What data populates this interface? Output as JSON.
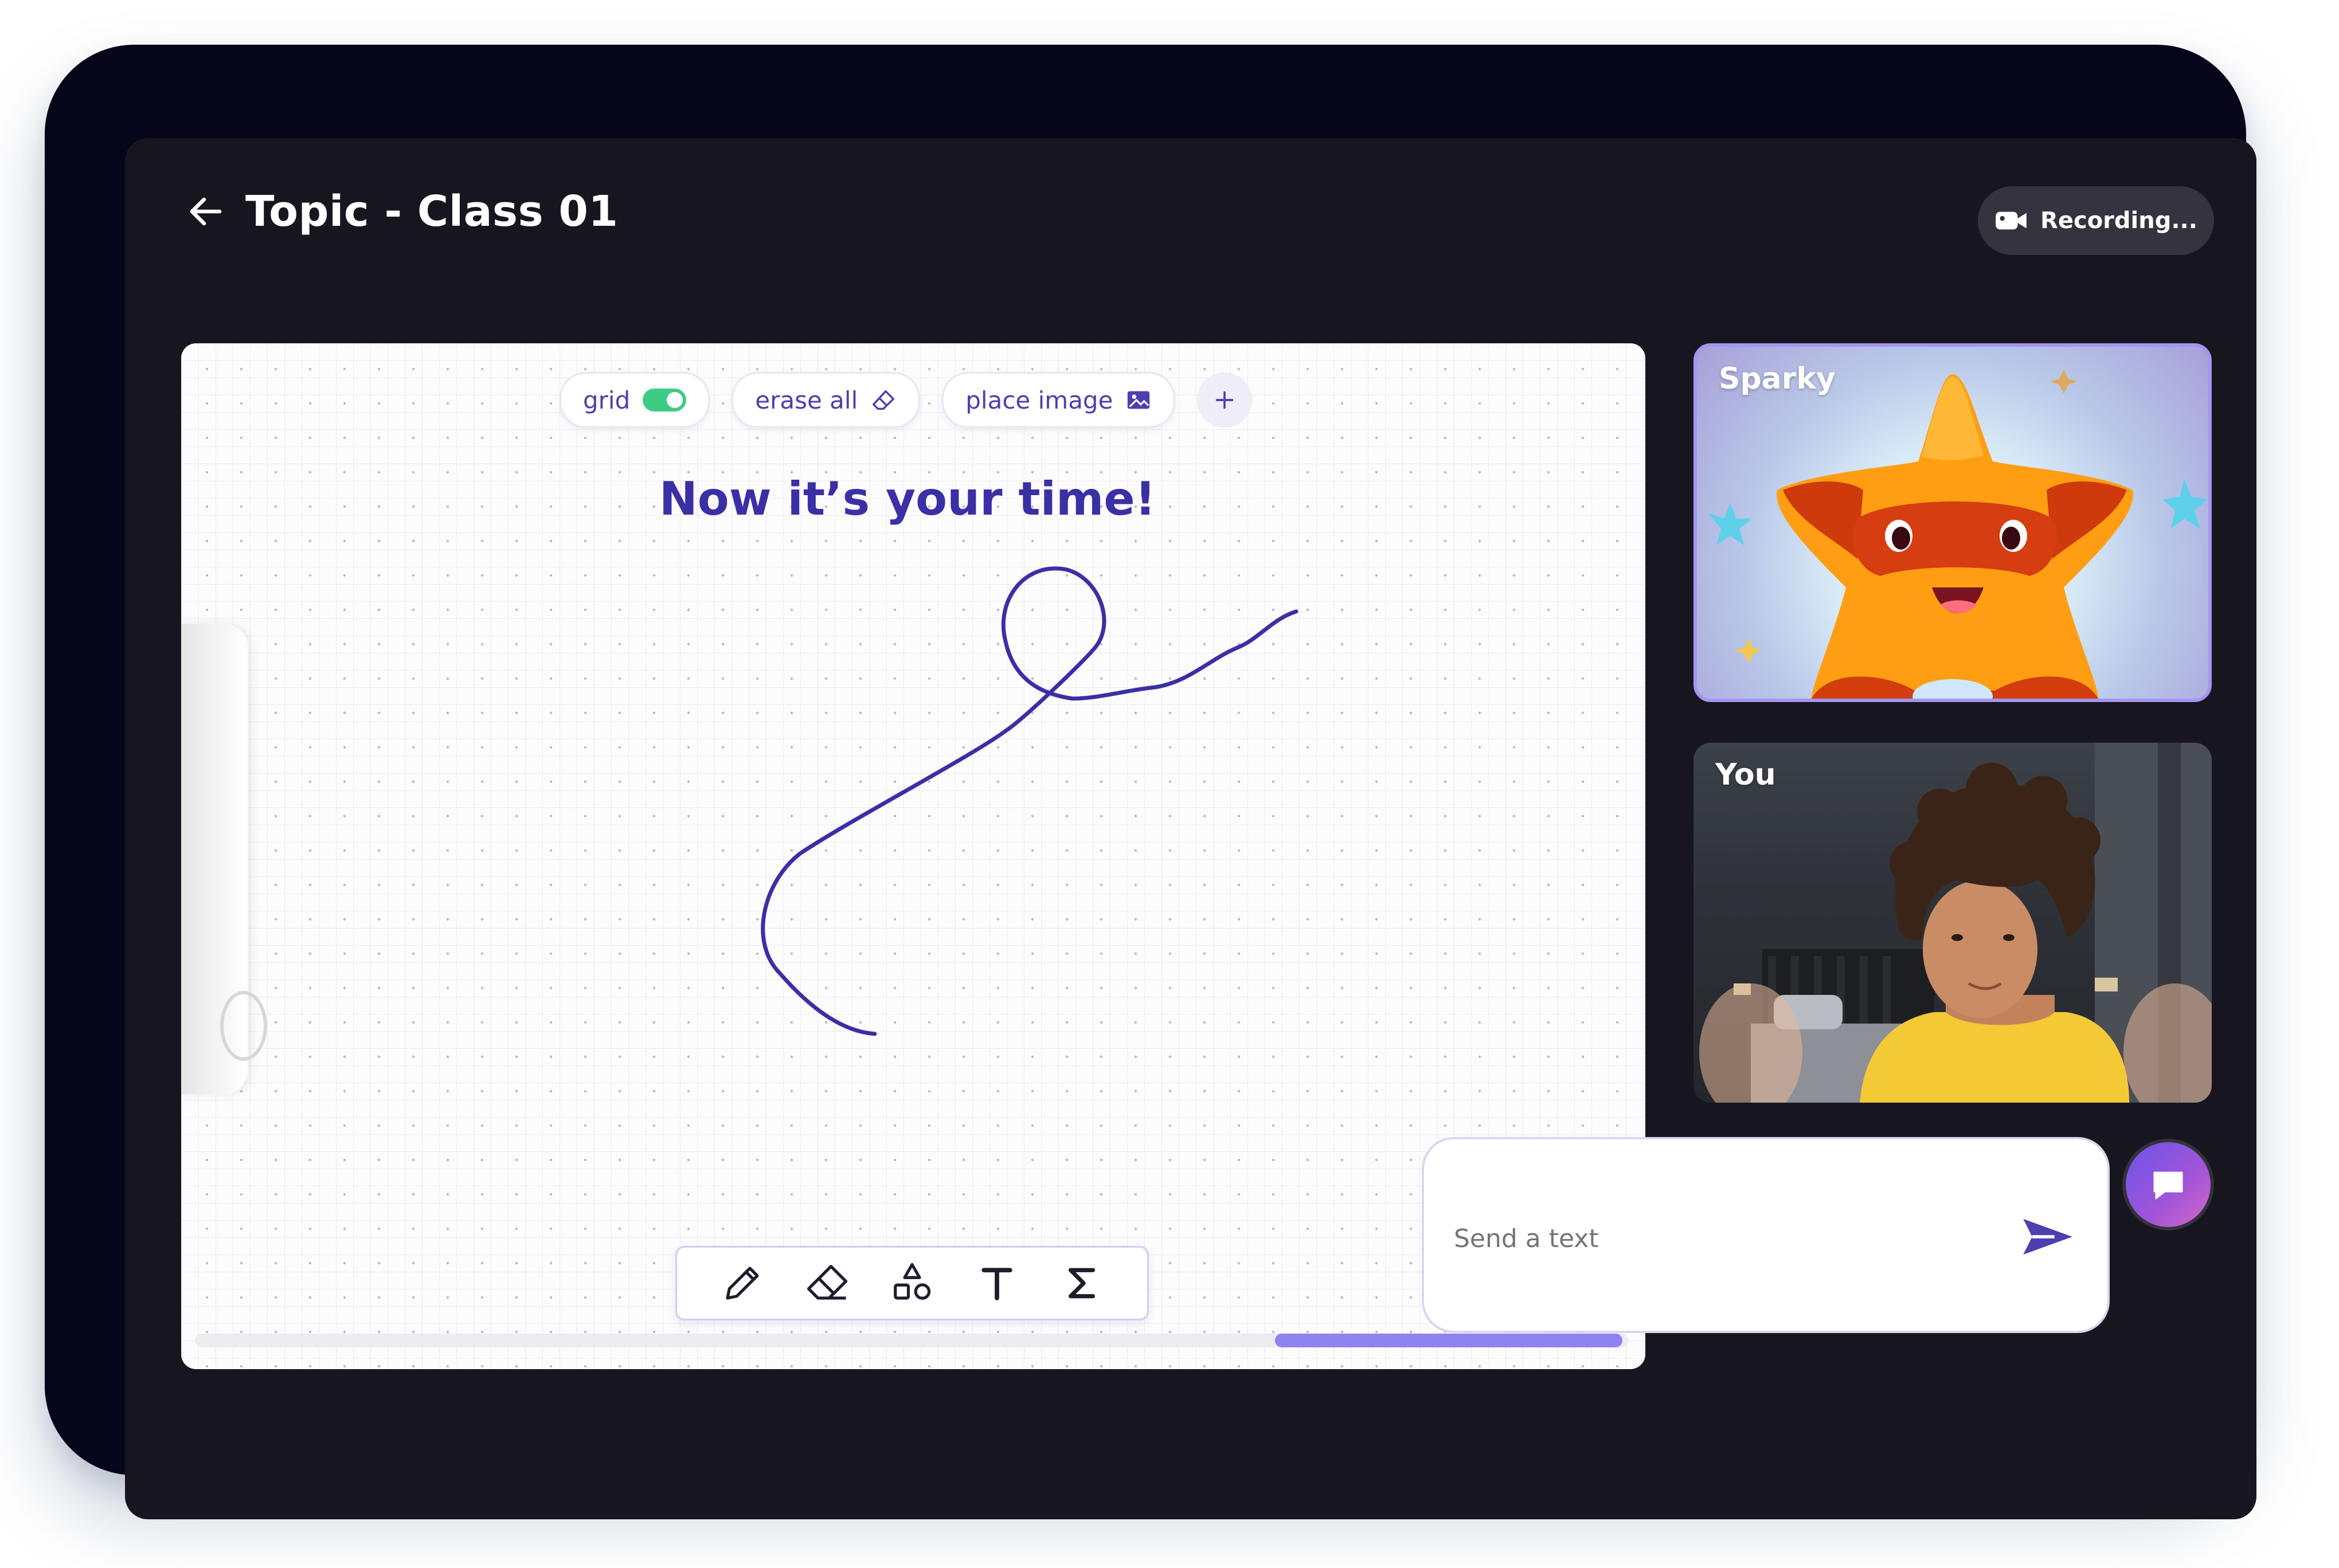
{
  "header": {
    "back_icon": "arrow-left-icon",
    "title": "Topic - Class 01",
    "recording_label": "Recording...",
    "recording_icon": "video-camera-icon"
  },
  "whiteboard": {
    "toolbar": {
      "grid_label": "grid",
      "grid_enabled": true,
      "erase_all_label": "erase all",
      "erase_icon": "eraser-icon",
      "place_image_label": "place image",
      "image_icon": "image-icon",
      "add_icon": "plus-icon"
    },
    "heading": "Now it’s your time!",
    "tools": [
      "pencil-icon",
      "eraser-icon",
      "shapes-icon",
      "text-icon",
      "sigma-icon"
    ],
    "stroke_color": "#3b2fa6"
  },
  "participants": [
    {
      "name": "Sparky",
      "avatar": "star-mascot"
    },
    {
      "name": "You",
      "avatar": "camera-feed"
    }
  ],
  "chat": {
    "placeholder": "Send a text",
    "send_icon": "send-icon",
    "chat_icon": "chat-bubble-icon"
  },
  "colors": {
    "accent": "#4c3fb0",
    "toggle_on": "#3ecb84",
    "scroll_thumb": "#8f83ef",
    "background": "#17161f"
  }
}
